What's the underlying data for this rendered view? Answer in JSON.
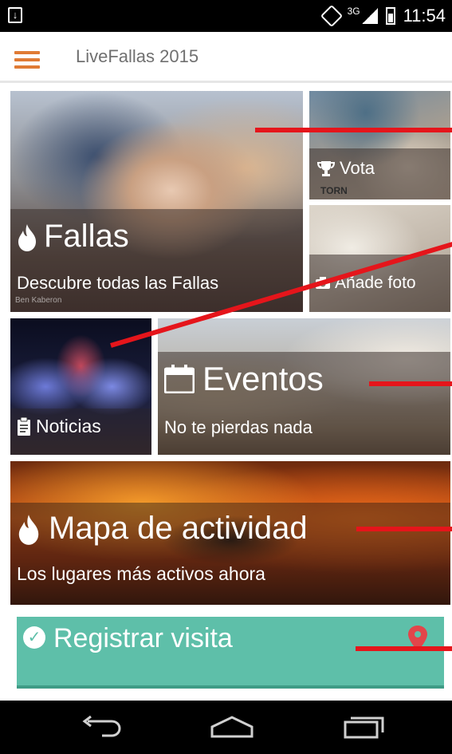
{
  "status_bar": {
    "signal_label": "3G",
    "time": "11:54"
  },
  "app_bar": {
    "title": "LiveFallas 2015"
  },
  "tiles": {
    "fallas": {
      "title": "Fallas",
      "subtitle": "Descubre todas las Fallas",
      "credit": "Ben Kaberon"
    },
    "vota": {
      "title": "Vota",
      "photo_text": "TORN"
    },
    "foto": {
      "title": "Añade foto"
    },
    "noticias": {
      "title": "Noticias"
    },
    "eventos": {
      "title": "Eventos",
      "subtitle": "No te pierdas nada"
    },
    "mapa": {
      "title": "Mapa de actividad",
      "subtitle": "Los lugares más activos ahora"
    }
  },
  "register": {
    "label": "Registrar visita"
  },
  "colors": {
    "accent": "#e07b35",
    "register_bg": "#5ebfa9",
    "annotation_red": "#e5151b",
    "pin_red": "#e2454a"
  },
  "icons": {
    "menu": "hamburger-icon",
    "fallas": "flame-icon",
    "vota": "trophy-icon",
    "foto": "camera-icon",
    "noticias": "clipboard-icon",
    "eventos": "calendar-icon",
    "mapa": "flame-icon",
    "register": "check-circle-icon",
    "register_right": "map-pin-icon",
    "nav_back": "back-icon",
    "nav_home": "home-icon",
    "nav_recents": "recents-icon"
  }
}
